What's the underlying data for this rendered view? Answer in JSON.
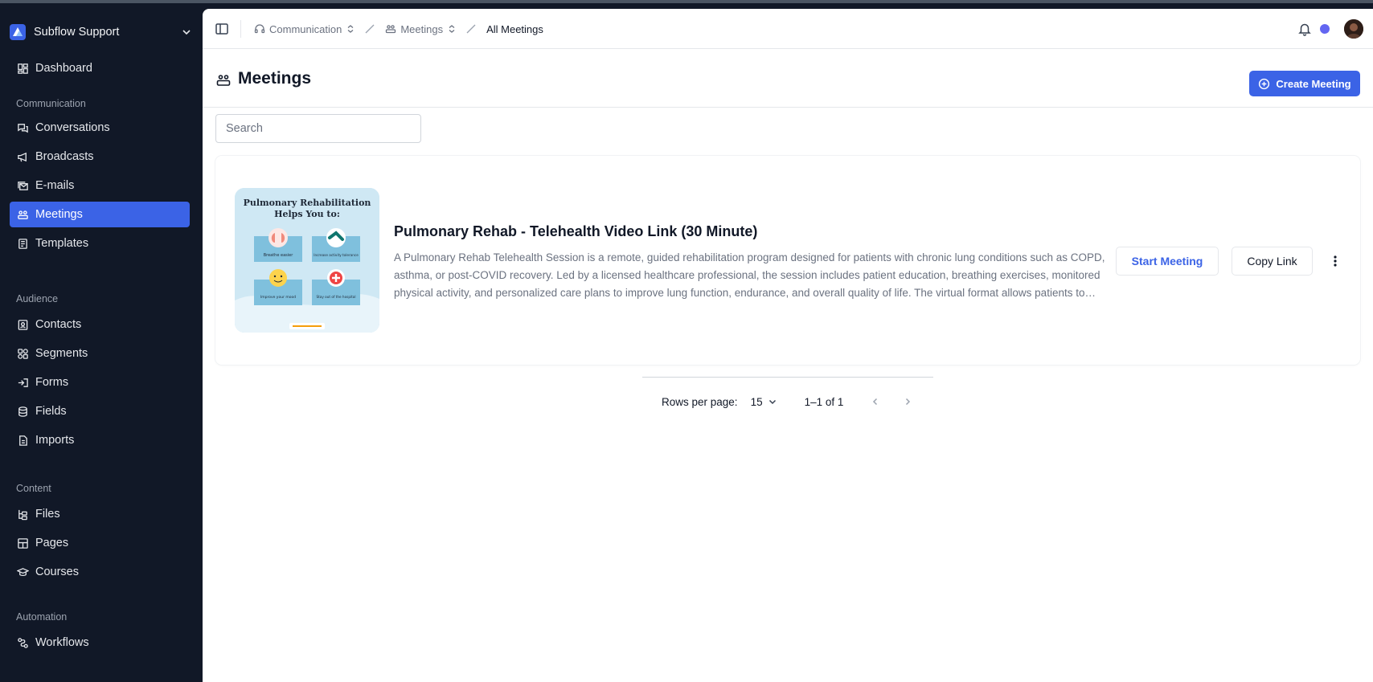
{
  "org": {
    "name": "Subflow Support"
  },
  "sidebar": {
    "dashboard": "Dashboard",
    "sections": [
      {
        "title": "Communication",
        "items": [
          "Conversations",
          "Broadcasts",
          "E-mails",
          "Meetings",
          "Templates"
        ]
      },
      {
        "title": "Audience",
        "items": [
          "Contacts",
          "Segments",
          "Forms",
          "Fields",
          "Imports"
        ]
      },
      {
        "title": "Content",
        "items": [
          "Files",
          "Pages",
          "Courses"
        ]
      },
      {
        "title": "Automation",
        "items": [
          "Workflows"
        ]
      }
    ],
    "active": "Meetings"
  },
  "breadcrumb": [
    "Communication",
    "Meetings",
    "All Meetings"
  ],
  "page": {
    "title": "Meetings",
    "create_label": "Create Meeting",
    "search_placeholder": "Search"
  },
  "meeting": {
    "title": "Pulmonary Rehab - Telehealth Video Link (30 Minute)",
    "description": "A Pulmonary Rehab Telehealth Session is a remote, guided rehabilitation program designed for patients with chronic lung conditions such as COPD, asthma, or post-COVID recovery. Led by a licensed healthcare professional, the session includes patient education, breathing exercises, monitored physical activity, and personalized care plans to improve lung function, endurance, and overall quality of life. The virtual format allows patients to participate from home.",
    "start_label": "Start Meeting",
    "copy_label": "Copy Link",
    "thumbnail": {
      "heading_line1": "Pulmonary Rehabilitation",
      "heading_line2": "Helps You to:",
      "tiles": [
        "Breathe easier",
        "Increase activity tolerance",
        "Improve your mood",
        "Stay out of the hospital"
      ]
    }
  },
  "pagination": {
    "rows_label": "Rows per page:",
    "rows_value": "15",
    "range": "1–1 of 1"
  },
  "colors": {
    "accent": "#3b63e6",
    "sidebar_bg": "#111827",
    "status_dot": "#6366f1"
  }
}
